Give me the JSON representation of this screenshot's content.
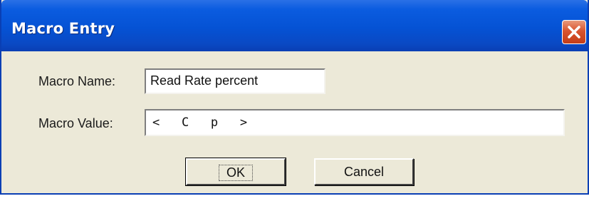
{
  "window": {
    "title": "Macro Entry",
    "close_icon": "close-x-icon"
  },
  "form": {
    "macro_name_label": "Macro Name:",
    "macro_name_value": "Read Rate percent",
    "macro_value_label": "Macro Value:",
    "macro_value_value": "<   C   p   >"
  },
  "buttons": {
    "ok_label": "OK",
    "cancel_label": "Cancel"
  },
  "colors": {
    "titlebar": "#0552D4",
    "dialog_background": "#ECE9D8",
    "close_button": "#D9542F"
  }
}
